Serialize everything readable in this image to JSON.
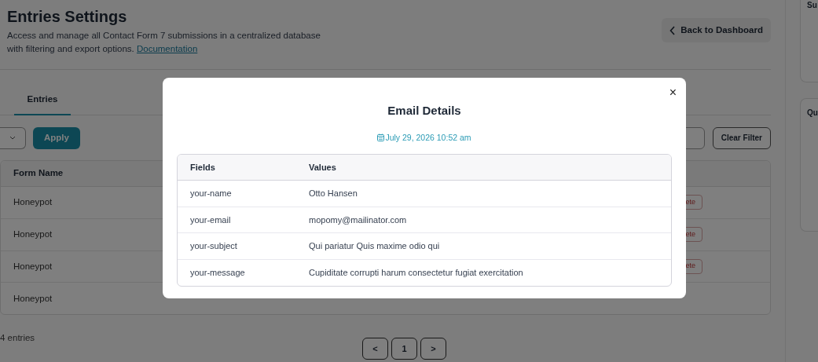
{
  "header": {
    "title": "Entries Settings",
    "description": "Access and manage all Contact Form 7 submissions in a centralized database with filtering and export options.",
    "link": "Documentation",
    "back_button": "Back to Dashboard"
  },
  "tabs": [
    {
      "label": "Entries",
      "selected": true
    }
  ],
  "filter": {
    "apply_button": "Apply",
    "clear_button": "Clear Filter"
  },
  "table": {
    "columns": [
      "Form Name"
    ],
    "rows": [
      {
        "form_name": "Honeypot",
        "actions": [
          "ete"
        ]
      },
      {
        "form_name": "Honeypot",
        "actions": [
          "ete"
        ]
      },
      {
        "form_name": "Honeypot",
        "actions": [
          "ete"
        ]
      },
      {
        "form_name": "Honeypot",
        "actions": []
      }
    ]
  },
  "footer": {
    "count": "4 entries",
    "pagination": [
      "<",
      "1",
      ">"
    ]
  },
  "sidebar": {
    "cards": [
      {
        "title": "Su"
      },
      {
        "title": "Qu"
      }
    ]
  },
  "modal": {
    "title": "Email Details",
    "date": "July 29, 2026 10:52 am",
    "close": "×",
    "columns": [
      "Fields",
      "Values"
    ],
    "rows": [
      {
        "field": "your-name",
        "value": "Otto Hansen"
      },
      {
        "field": "your-email",
        "value": "mopomy@mailinator.com"
      },
      {
        "field": "your-subject",
        "value": "Qui pariatur Quis maxime odio qui"
      },
      {
        "field": "your-message",
        "value": "Cupiditate corrupti harum consectetur fugiat exercitation"
      }
    ]
  }
}
